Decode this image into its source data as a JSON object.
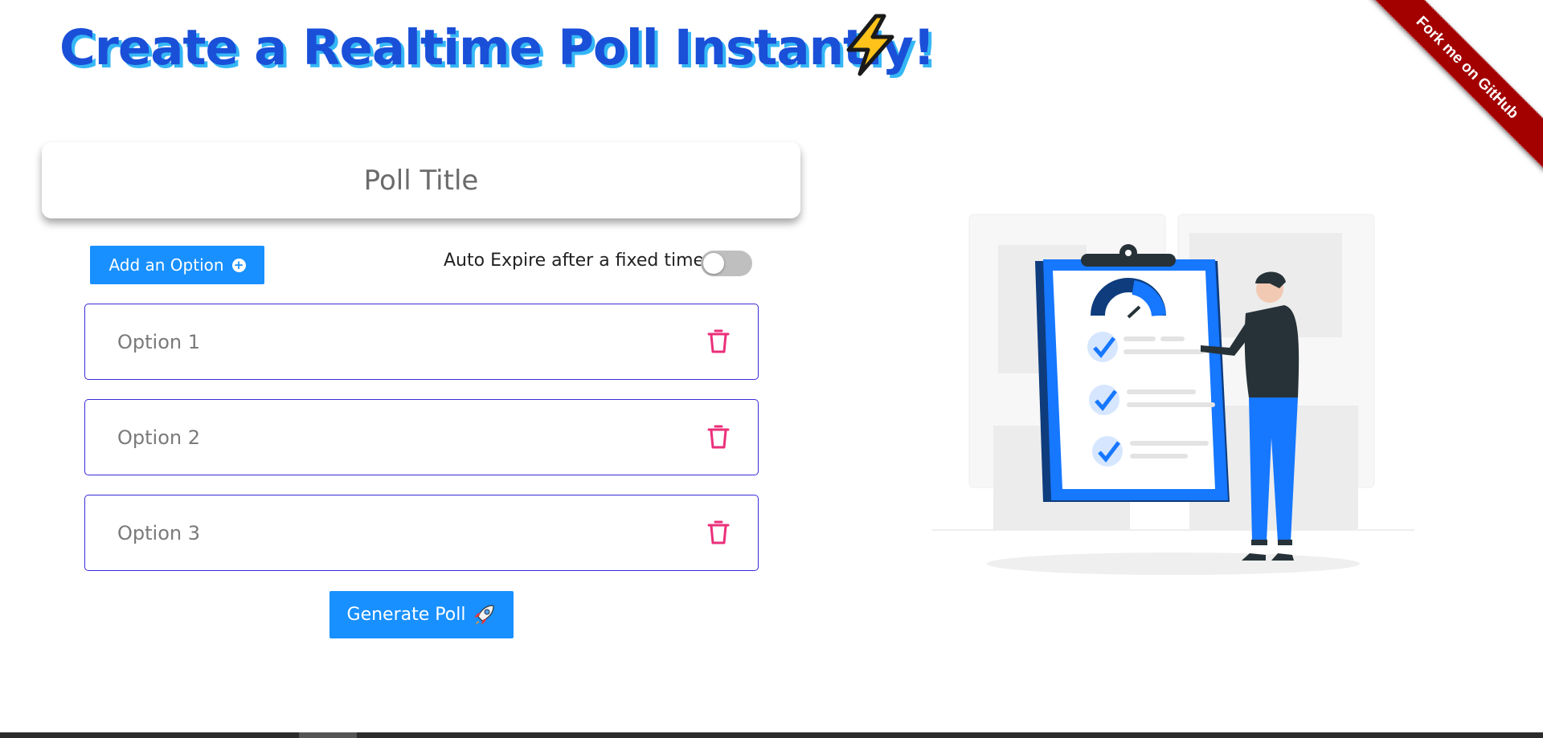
{
  "header": {
    "title": "Create a Realtime Poll Instantly!",
    "title_icon": "lightning-bolt-icon"
  },
  "ribbon": {
    "label": "Fork me on GitHub",
    "color": "#a30000"
  },
  "poll_form": {
    "title_placeholder": "Poll Title",
    "add_option_label": "Add an Option",
    "auto_expire_label": "Auto Expire after a fixed time",
    "auto_expire_enabled": false,
    "options": [
      {
        "placeholder": "Option 1"
      },
      {
        "placeholder": "Option 2"
      },
      {
        "placeholder": "Option 3"
      }
    ],
    "generate_label": "Generate Poll",
    "generate_icon": "rocket-icon"
  },
  "colors": {
    "primary_button": "#1890ff",
    "option_border": "#3a2bd8",
    "delete_icon": "#eb2f7a",
    "title_text": "#1a4fd8",
    "title_shadow": "#35b7f5"
  }
}
